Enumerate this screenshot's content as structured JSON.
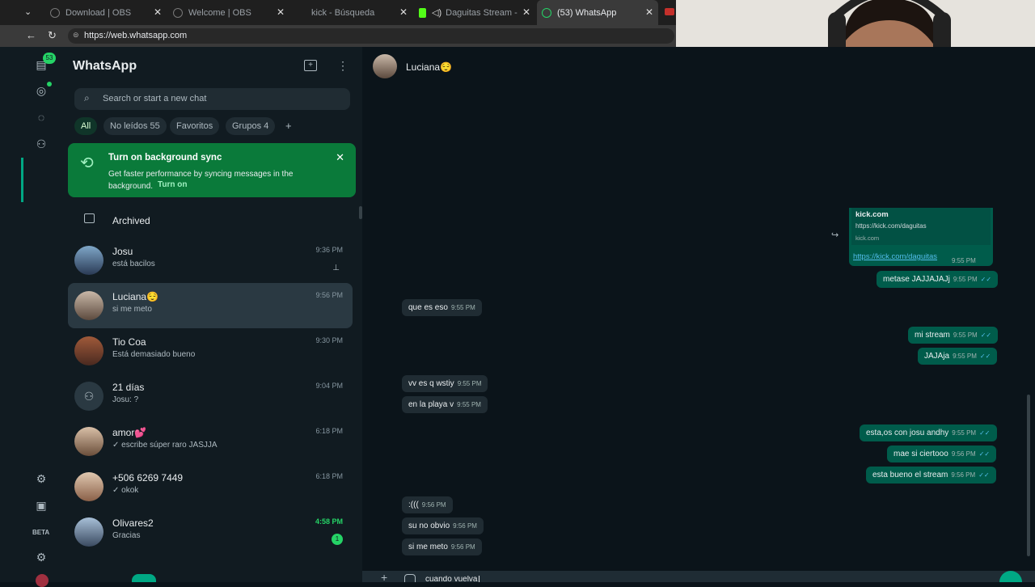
{
  "browser": {
    "tabs": [
      {
        "label": "Download | OBS"
      },
      {
        "label": "Welcome | OBS"
      },
      {
        "label": "kick - Búsqueda"
      },
      {
        "label": "Daguitas Stream - Watc"
      },
      {
        "label": "(53) WhatsApp"
      }
    ],
    "url": "https://web.whatsapp.com"
  },
  "rail": {
    "badge": "53",
    "beta": "BETA"
  },
  "sidebar": {
    "title": "WhatsApp",
    "search_placeholder": "Search or start a new chat",
    "filters": [
      {
        "label": "All"
      },
      {
        "label": "No leídos 55"
      },
      {
        "label": "Favoritos"
      },
      {
        "label": "Grupos 4"
      },
      {
        "label": "+"
      }
    ],
    "sync": {
      "title": "Turn on background sync",
      "text": "Get faster performance by syncing messages in the background.",
      "link": "Turn on"
    },
    "archived": "Archived",
    "chats": [
      {
        "name": "Josu",
        "preview": "está bacilos",
        "time": "9:36 PM"
      },
      {
        "name": "Luciana😌",
        "preview": "si me meto",
        "time": "9:56 PM"
      },
      {
        "name": "Tio Coa",
        "preview": "Está demasiado bueno",
        "time": "9:30 PM"
      },
      {
        "name": "21 días",
        "preview": "Josu: ?",
        "time": "9:04 PM"
      },
      {
        "name": "amor💕",
        "preview": "✓ escribe súper raro JASJJA",
        "time": "6:18 PM"
      },
      {
        "name": "+506 6269 7449",
        "preview": "✓ okok",
        "time": "6:18 PM"
      },
      {
        "name": "Olivares2",
        "preview": "Gracias",
        "time": "4:58 PM",
        "unread": "1"
      }
    ]
  },
  "chat": {
    "contact": "Luciana😌",
    "link_preview": {
      "title": "kick.com",
      "url": "https://kick.com/daguitas",
      "domain": "kick.com",
      "link": "https://kick.com/daguitas",
      "time": "9:55 PM"
    },
    "messages": [
      {
        "dir": "out",
        "text": "metase JAJJAJAJj",
        "time": "9:55 PM"
      },
      {
        "dir": "in",
        "text": "que es eso",
        "time": "9:55 PM"
      },
      {
        "dir": "out",
        "text": "mi stream",
        "time": "9:55 PM"
      },
      {
        "dir": "out",
        "text": "JAJAja",
        "time": "9:55 PM"
      },
      {
        "dir": "in",
        "text": "vv es q wstiy",
        "time": "9:55 PM"
      },
      {
        "dir": "in",
        "text": "en la playa v",
        "time": "9:55 PM"
      },
      {
        "dir": "out",
        "text": "esta,os con josu andhy",
        "time": "9:55 PM"
      },
      {
        "dir": "out",
        "text": "mae si ciertooo",
        "time": "9:56 PM"
      },
      {
        "dir": "out",
        "text": "esta bueno el stream",
        "time": "9:56 PM"
      },
      {
        "dir": "in",
        "text": ":(((",
        "time": "9:56 PM"
      },
      {
        "dir": "in",
        "text": "su no obvio",
        "time": "9:56 PM"
      },
      {
        "dir": "in",
        "text": "si me meto",
        "time": "9:56 PM"
      }
    ],
    "composer": "cuando vuelva"
  },
  "colors": {
    "accent": "#00a884",
    "sync_banner": "#0a7a3a",
    "outgoing": "#005c4b",
    "incoming": "#202c33"
  }
}
